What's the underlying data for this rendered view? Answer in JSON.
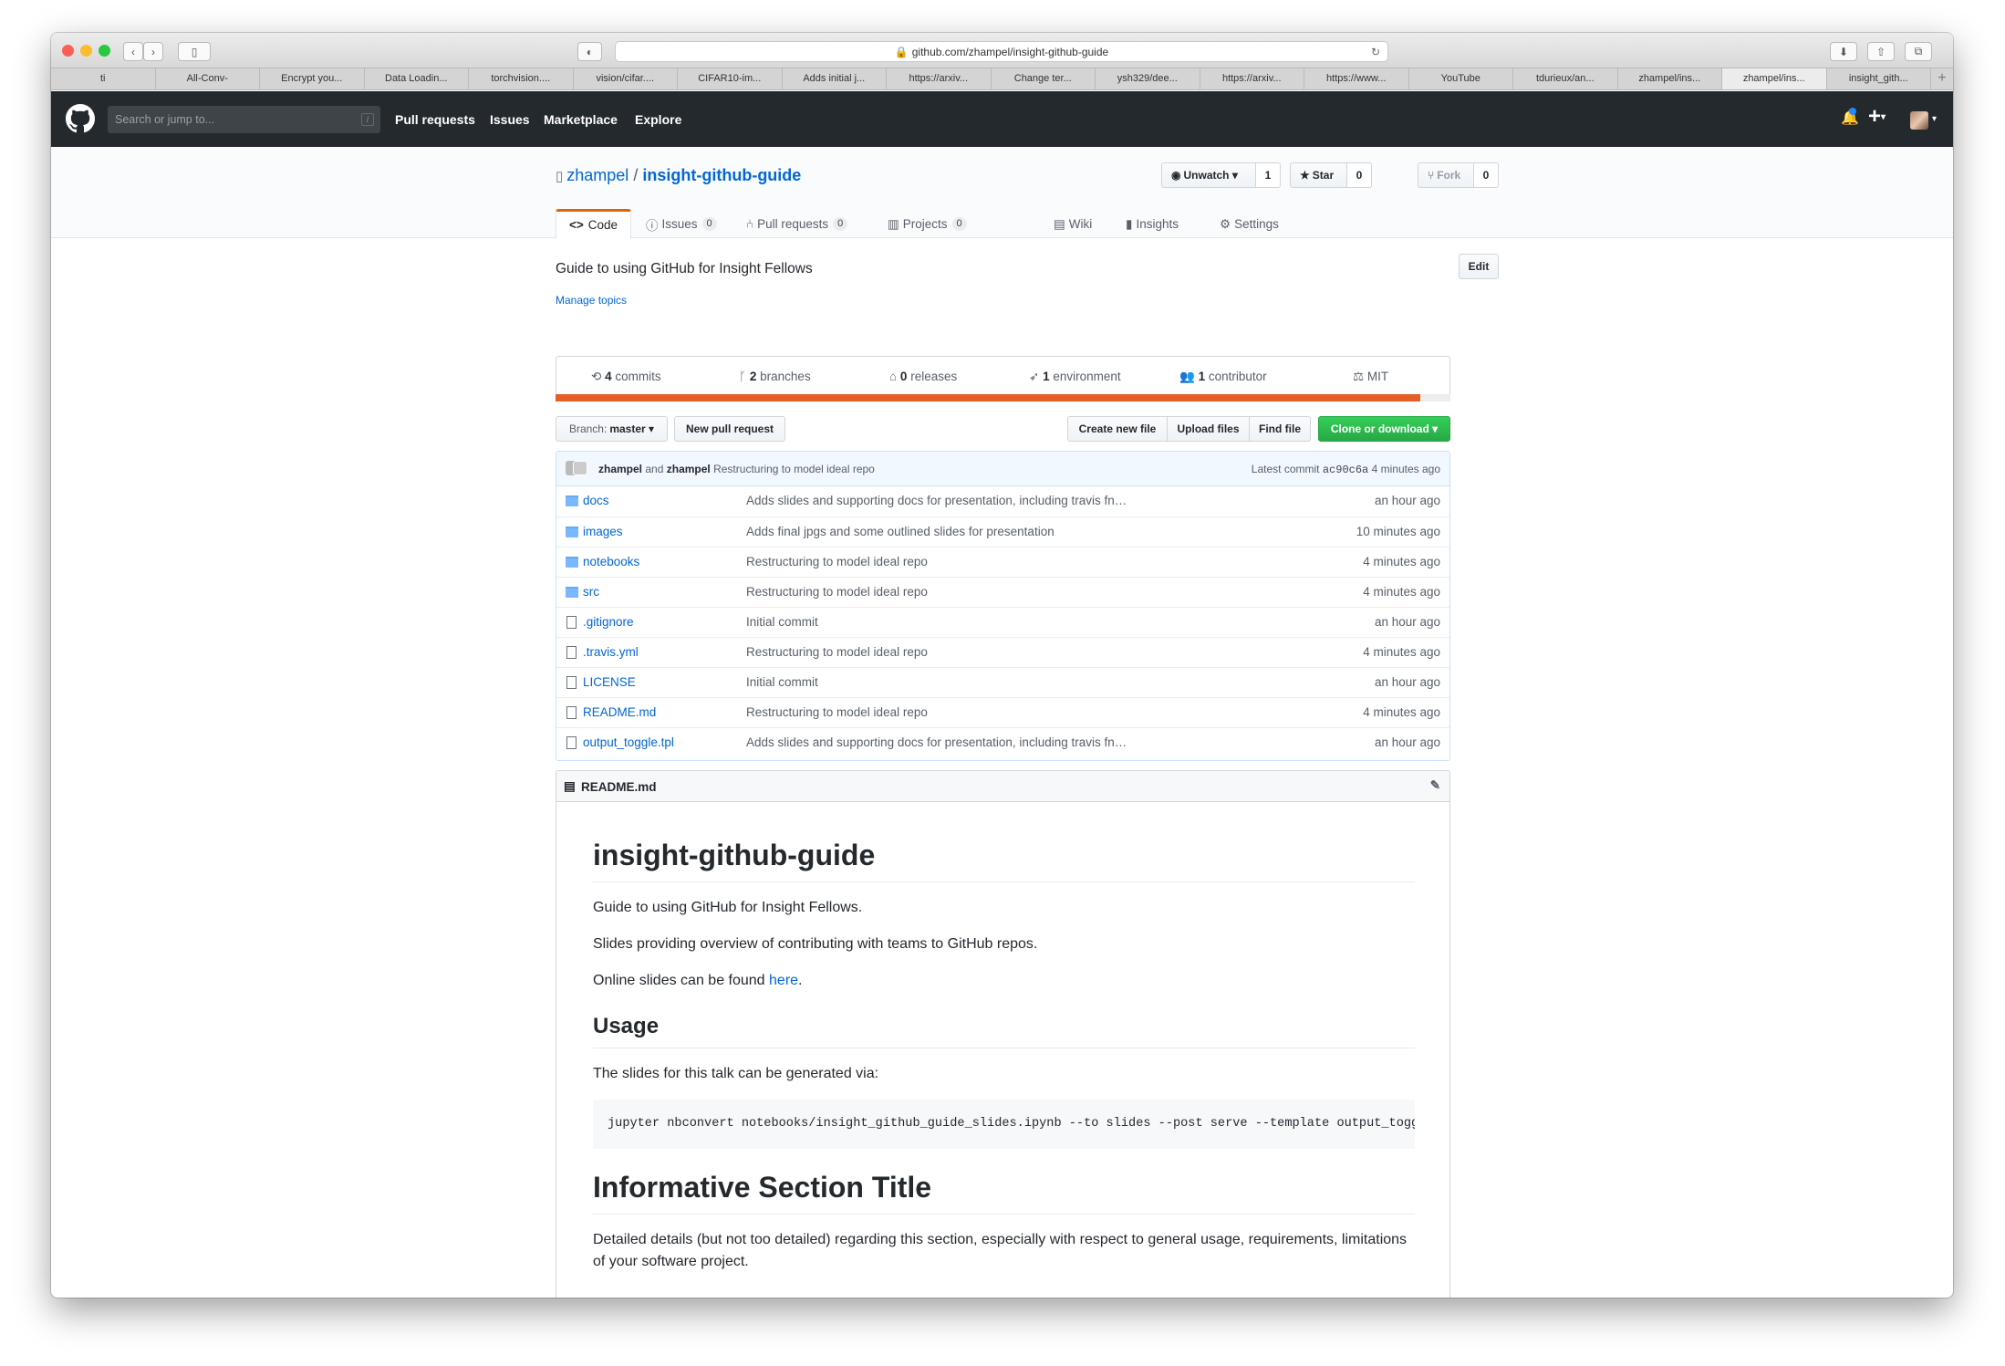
{
  "browser": {
    "url": "github.com/zhampel/insight-github-guide",
    "tabs": [
      "ti",
      "All-Conv-",
      "Encrypt you...",
      "Data Loadin...",
      "torchvision....",
      "vision/cifar....",
      "CIFAR10-im...",
      "Adds initial j...",
      "https://arxiv...",
      "Change ter...",
      "ysh329/dee...",
      "https://arxiv...",
      "https://www...",
      "YouTube",
      "tdurieux/an...",
      "zhampel/ins...",
      "zhampel/ins...",
      "insight_gith..."
    ],
    "active_tab": 16
  },
  "github": {
    "search_placeholder": "Search or jump to...",
    "search_key": "/",
    "nav": [
      "Pull requests",
      "Issues",
      "Marketplace",
      "Explore"
    ]
  },
  "repo": {
    "owner": "zhampel",
    "sep": "/",
    "name": "insight-github-guide",
    "watch_label": "Unwatch",
    "watch_count": "1",
    "star_label": "Star",
    "star_count": "0",
    "fork_label": "Fork",
    "fork_count": "0",
    "tabs": [
      {
        "label": "Code"
      },
      {
        "label": "Issues",
        "count": "0"
      },
      {
        "label": "Pull requests",
        "count": "0"
      },
      {
        "label": "Projects",
        "count": "0"
      },
      {
        "label": "Wiki"
      },
      {
        "label": "Insights"
      },
      {
        "label": "Settings"
      }
    ],
    "description": "Guide to using GitHub for Insight Fellows",
    "edit_label": "Edit",
    "manage_topics": "Manage topics",
    "summary": [
      {
        "num": "4",
        "text": "commits"
      },
      {
        "num": "2",
        "text": "branches"
      },
      {
        "num": "0",
        "text": "releases"
      },
      {
        "num": "1",
        "text": "environment"
      },
      {
        "num": "1",
        "text": "contributor"
      },
      {
        "num": "",
        "text": "MIT"
      }
    ],
    "language_fraction": 0.966,
    "language_color": "#e35d25",
    "branch_label": "Branch:",
    "branch": "master",
    "new_pr": "New pull request",
    "create_file": "Create new file",
    "upload_files": "Upload files",
    "find_file": "Find file",
    "clone": "Clone or download",
    "commit": {
      "author1": "zhampel",
      "and": "and",
      "author2": "zhampel",
      "message": "Restructuring to model ideal repo",
      "latest_label": "Latest commit",
      "sha": "ac90c6a",
      "age": "4 minutes ago"
    },
    "files": [
      {
        "name": "docs",
        "type": "dir",
        "msg": "Adds slides and supporting docs for presentation, including travis fn…",
        "age": "an hour ago"
      },
      {
        "name": "images",
        "type": "dir",
        "msg": "Adds final jpgs and some outlined slides for presentation",
        "age": "10 minutes ago"
      },
      {
        "name": "notebooks",
        "type": "dir",
        "msg": "Restructuring to model ideal repo",
        "age": "4 minutes ago"
      },
      {
        "name": "src",
        "type": "dir",
        "msg": "Restructuring to model ideal repo",
        "age": "4 minutes ago"
      },
      {
        "name": ".gitignore",
        "type": "file",
        "msg": "Initial commit",
        "age": "an hour ago"
      },
      {
        "name": ".travis.yml",
        "type": "file",
        "msg": "Restructuring to model ideal repo",
        "age": "4 minutes ago"
      },
      {
        "name": "LICENSE",
        "type": "file",
        "msg": "Initial commit",
        "age": "an hour ago"
      },
      {
        "name": "README.md",
        "type": "file",
        "msg": "Restructuring to model ideal repo",
        "age": "4 minutes ago"
      },
      {
        "name": "output_toggle.tpl",
        "type": "file",
        "msg": "Adds slides and supporting docs for presentation, including travis fn…",
        "age": "an hour ago"
      }
    ]
  },
  "readme": {
    "header": "README.md",
    "h1": "insight-github-guide",
    "p1": "Guide to using GitHub for Insight Fellows.",
    "p2": "Slides providing overview of contributing with teams to GitHub repos.",
    "p3_before": "Online slides can be found ",
    "p3_link": "here",
    "p3_after": ".",
    "h2_usage": "Usage",
    "p4": "The slides for this talk can be generated via:",
    "code": "jupyter nbconvert notebooks/insight_github_guide_slides.ipynb --to slides --post serve --template output_toggle",
    "h1_section": "Informative Section Title",
    "p5": "Detailed details (but not too detailed) regarding this section, especially with respect to general usage, requirements, limitations of your software project."
  }
}
